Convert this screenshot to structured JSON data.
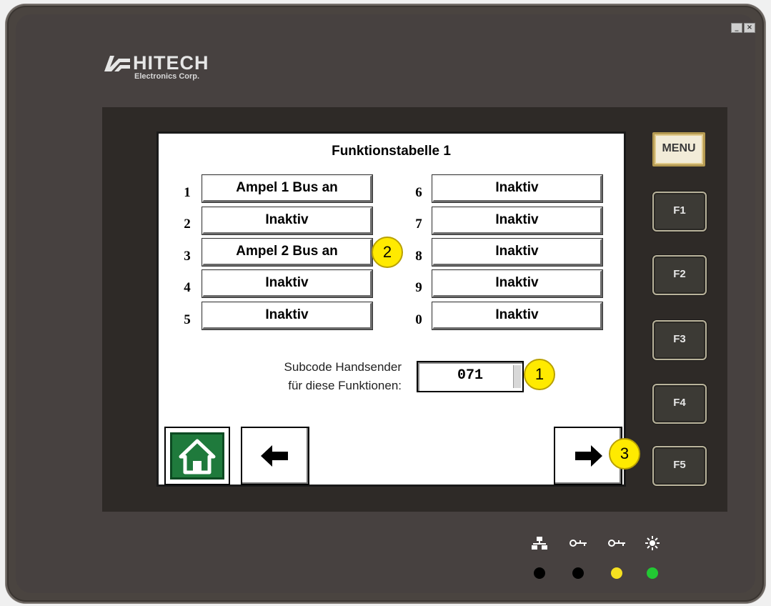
{
  "window_controls": {
    "minimize": "_",
    "close": "×"
  },
  "brand": {
    "name": "HITECH",
    "subtitle": "Electronics Corp."
  },
  "screen": {
    "title": "Funktionstabelle 1",
    "left_column": [
      {
        "num": "1",
        "label": "Ampel 1 Bus an"
      },
      {
        "num": "2",
        "label": "Inaktiv"
      },
      {
        "num": "3",
        "label": "Ampel 2 Bus an"
      },
      {
        "num": "4",
        "label": "Inaktiv"
      },
      {
        "num": "5",
        "label": "Inaktiv"
      }
    ],
    "right_column": [
      {
        "num": "6",
        "label": "Inaktiv"
      },
      {
        "num": "7",
        "label": "Inaktiv"
      },
      {
        "num": "8",
        "label": "Inaktiv"
      },
      {
        "num": "9",
        "label": "Inaktiv"
      },
      {
        "num": "0",
        "label": "Inaktiv"
      }
    ],
    "subcode": {
      "label_line1": "Subcode Handsender",
      "label_line2": "für diese Funktionen:",
      "value": "071"
    },
    "nav": {
      "home_icon": "home-icon",
      "back_icon": "arrow-left-icon",
      "forward_icon": "arrow-right-icon"
    }
  },
  "side_buttons": {
    "menu": "MENU",
    "f1": "F1",
    "f2": "F2",
    "f3": "F3",
    "f4": "F4",
    "f5": "F5"
  },
  "callouts": {
    "c1": "1",
    "c2": "2",
    "c3": "3"
  },
  "indicators": {
    "icons": [
      "network-icon",
      "key-icon",
      "key-icon",
      "light-icon"
    ],
    "leds": [
      "#000000",
      "#000000",
      "#f5e020",
      "#22c833"
    ]
  }
}
